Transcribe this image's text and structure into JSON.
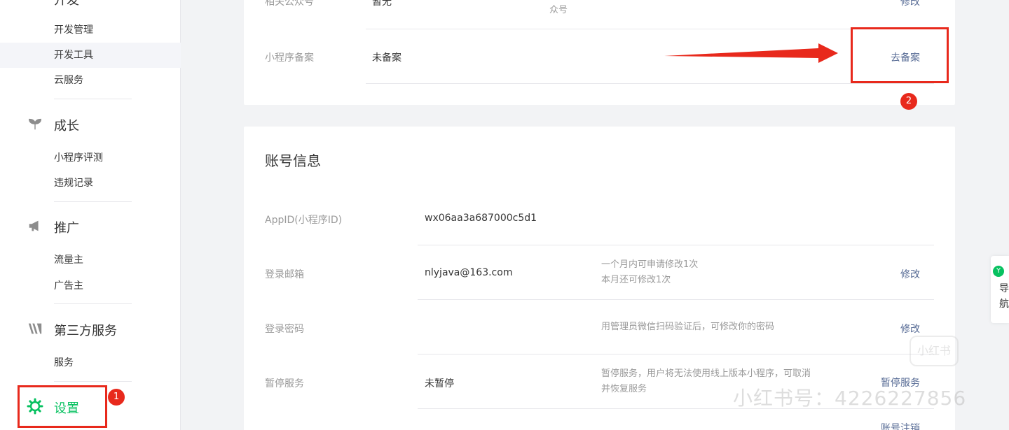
{
  "sidebar": {
    "top_section_title": "开发",
    "dev_items": [
      {
        "label": "开发管理"
      },
      {
        "label": "开发工具"
      },
      {
        "label": "云服务"
      }
    ],
    "growth": {
      "title": "成长",
      "items": [
        {
          "label": "小程序评测"
        },
        {
          "label": "违规记录"
        }
      ]
    },
    "promotion": {
      "title": "推广",
      "items": [
        {
          "label": "流量主"
        },
        {
          "label": "广告主"
        }
      ]
    },
    "third_party": {
      "title": "第三方服务",
      "items": [
        {
          "label": "服务"
        }
      ]
    },
    "settings": {
      "title": "设置"
    }
  },
  "top_card": {
    "related_account": {
      "label": "相关公众号",
      "value": "暂无",
      "desc": "众号",
      "action": "修改"
    },
    "filing": {
      "label": "小程序备案",
      "value": "未备案",
      "action": "去备案"
    }
  },
  "account_card": {
    "title": "账号信息",
    "appid": {
      "label": "AppID(小程序ID)",
      "value": "wx06aa3a687000c5d1"
    },
    "email": {
      "label": "登录邮箱",
      "value": "nlyjava@163.com",
      "desc_line1": "一个月内可申请修改1次",
      "desc_line2": "本月还可修改1次",
      "action": "修改"
    },
    "password": {
      "label": "登录密码",
      "desc": "用管理员微信扫码验证后，可修改你的密码",
      "action": "修改"
    },
    "suspend": {
      "label": "暂停服务",
      "value": "未暂停",
      "desc_line1": "暂停服务，用户将无法使用线上版本小程序，可取消",
      "desc_line2": "并恢复服务",
      "action": "暂停服务"
    },
    "cancel": {
      "action": "账号注销"
    }
  },
  "annotations": {
    "badge1": "1",
    "badge2": "2",
    "color": "#e8291c"
  },
  "float_helper": {
    "icon_char": "Y",
    "line1": "导",
    "line2": "航"
  },
  "watermark": {
    "text": "小红书号：4226227856",
    "logo": "小红书"
  },
  "colors": {
    "accent": "#07c160",
    "link": "#576b95",
    "annotation": "#e8291c"
  }
}
